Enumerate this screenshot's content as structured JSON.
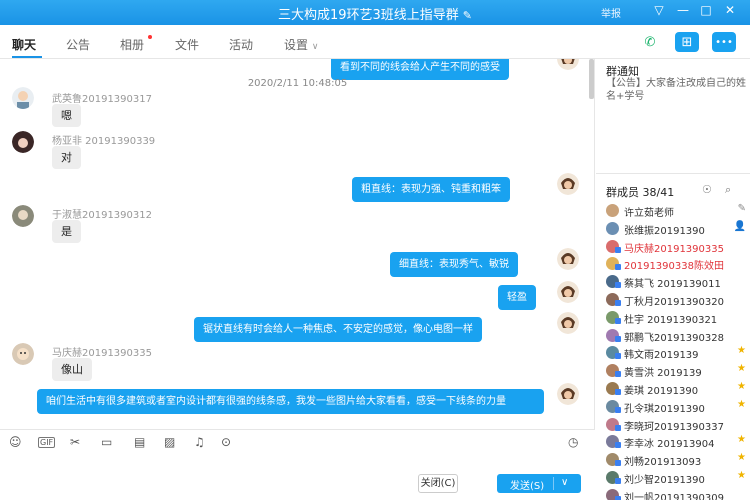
{
  "window": {
    "title": "三大构成19环艺3班线上指导群",
    "report": "举报",
    "controls": [
      "▽",
      "—",
      "□",
      "✕"
    ]
  },
  "tabs": [
    {
      "label": "聊天"
    },
    {
      "label": "公告"
    },
    {
      "label": "相册"
    },
    {
      "label": "文件"
    },
    {
      "label": "活动"
    },
    {
      "label": "设置"
    }
  ],
  "chat": {
    "partial_message": "看到不同的线会给人产生不同的感受",
    "timestamp": "2020/2/11 10:48:05",
    "messages": [
      {
        "dir": "in",
        "sender": "武英鲁20191390317",
        "text": "嗯"
      },
      {
        "dir": "in",
        "sender": "杨亚非 20191390339",
        "text": "对"
      },
      {
        "dir": "out",
        "text": "粗直线：表现力强、钝重和粗笨"
      },
      {
        "dir": "in",
        "sender": "于淑慧20191390312",
        "text": "是"
      },
      {
        "dir": "out",
        "text": "细直线：表现秀气、敏锐"
      },
      {
        "dir": "out",
        "text": "轻盈"
      },
      {
        "dir": "out",
        "text": "锯状直线有时会给人一种焦虑、不安定的感觉，像心电图一样"
      },
      {
        "dir": "in",
        "sender": "马庆赫20191390335",
        "text": "像山"
      },
      {
        "dir": "out",
        "text": "咱们生活中有很多建筑或者室内设计都有很强的线条感，我发一些图片给大家看看，感受一下线条的力量"
      }
    ]
  },
  "buttons": {
    "close": "关闭(C)",
    "send": "发送(S)"
  },
  "sidebar": {
    "notice_title": "群通知",
    "notice_text": "【公告】大家备注改成自己的姓名+学号",
    "members_title": "群成员 38/41",
    "members": [
      {
        "name": "许立茹老师",
        "icon": "owner"
      },
      {
        "name": "张维振20191390",
        "icon": "admin"
      },
      {
        "name": "马庆赫20191390335",
        "red": true
      },
      {
        "name": "20191390338陈效田",
        "red": true
      },
      {
        "name": "蔡其飞 2019139011"
      },
      {
        "name": "丁秋月20191390320"
      },
      {
        "name": "杜宇 20191390321"
      },
      {
        "name": "郭鹏飞20191390328"
      },
      {
        "name": "韩文雨2019139",
        "icon": "star"
      },
      {
        "name": "黄雪洪 2019139",
        "icon": "star"
      },
      {
        "name": "姜琪 20191390",
        "icon": "star"
      },
      {
        "name": "孔令琪20191390",
        "icon": "star"
      },
      {
        "name": "李晓珂20191390337"
      },
      {
        "name": "李幸冰 201913904",
        "icon": "star"
      },
      {
        "name": "刘畅201913093",
        "icon": "star"
      },
      {
        "name": "刘少智20191390",
        "icon": "star"
      },
      {
        "name": "刘一帆20191390309"
      }
    ]
  },
  "colors": {
    "accent": "#19a2f0",
    "titlebar": "#1a93e6",
    "bubble_in": "#ededed",
    "member_red": "#e0343a"
  }
}
